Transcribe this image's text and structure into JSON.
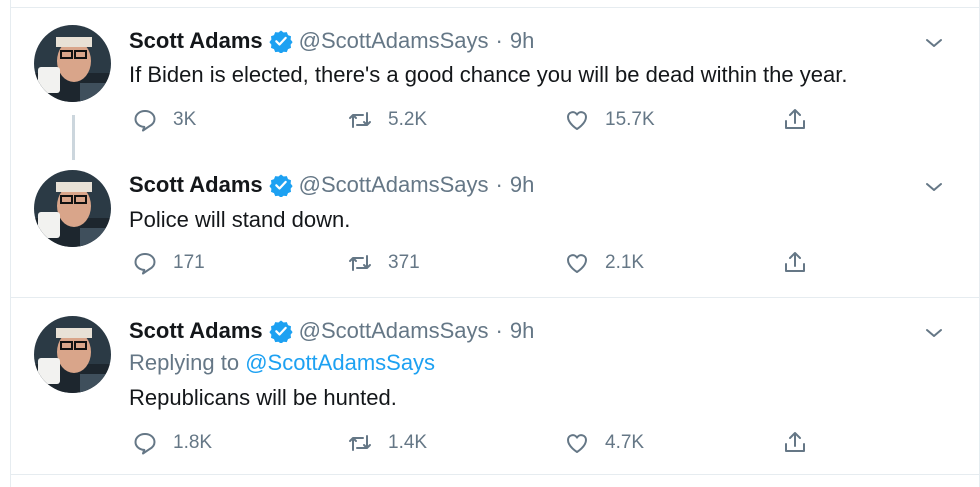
{
  "colors": {
    "accent": "#1da1f2",
    "secondary_text": "#657786",
    "primary_text": "#14171a",
    "divider": "#e6ecf0"
  },
  "icons": {
    "reply": "reply-icon",
    "retweet": "retweet-icon",
    "like": "heart-icon",
    "share": "share-icon",
    "verified": "verified-badge-icon",
    "menu": "chevron-down-icon"
  },
  "tweets": [
    {
      "author": "Scott Adams",
      "handle": "@ScottAdamsSays",
      "separator": "·",
      "time": "9h",
      "text": "If Biden is elected, there's a good chance you will be dead within the year.",
      "stats": {
        "replies": "3K",
        "retweets": "5.2K",
        "likes": "15.7K"
      }
    },
    {
      "author": "Scott Adams",
      "handle": "@ScottAdamsSays",
      "separator": "·",
      "time": "9h",
      "text": "Police will stand down.",
      "stats": {
        "replies": "171",
        "retweets": "371",
        "likes": "2.1K"
      }
    },
    {
      "author": "Scott Adams",
      "handle": "@ScottAdamsSays",
      "separator": "·",
      "time": "9h",
      "replying_prefix": "Replying to",
      "replying_to": "@ScottAdamsSays",
      "text": "Republicans will be hunted.",
      "stats": {
        "replies": "1.8K",
        "retweets": "1.4K",
        "likes": "4.7K"
      }
    }
  ]
}
